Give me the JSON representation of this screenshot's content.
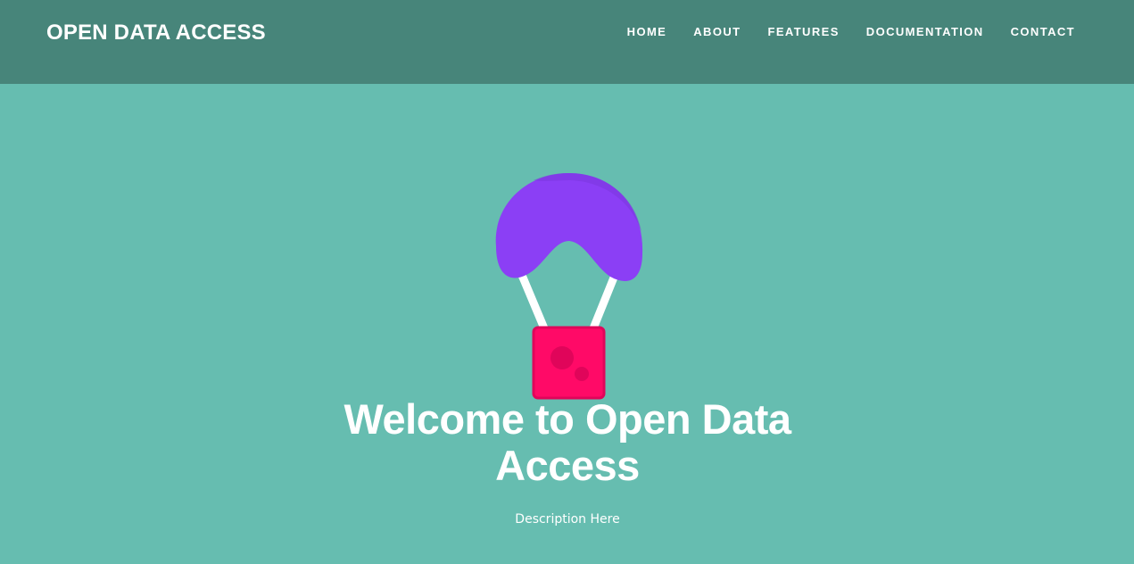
{
  "header": {
    "brand": "OPEN DATA ACCESS",
    "nav": [
      "HOME",
      "ABOUT",
      "FEATURES",
      "DOCUMENTATION",
      "CONTACT"
    ]
  },
  "hero": {
    "logo_icon": "parachute-icon",
    "title": "Welcome to Open Data Access",
    "description": "Description Here"
  },
  "colors": {
    "navbar": "#47857a",
    "background": "#66bdb0",
    "canopy": "#8b3ff5",
    "box": "#ff0a67",
    "text": "#ffffff"
  }
}
